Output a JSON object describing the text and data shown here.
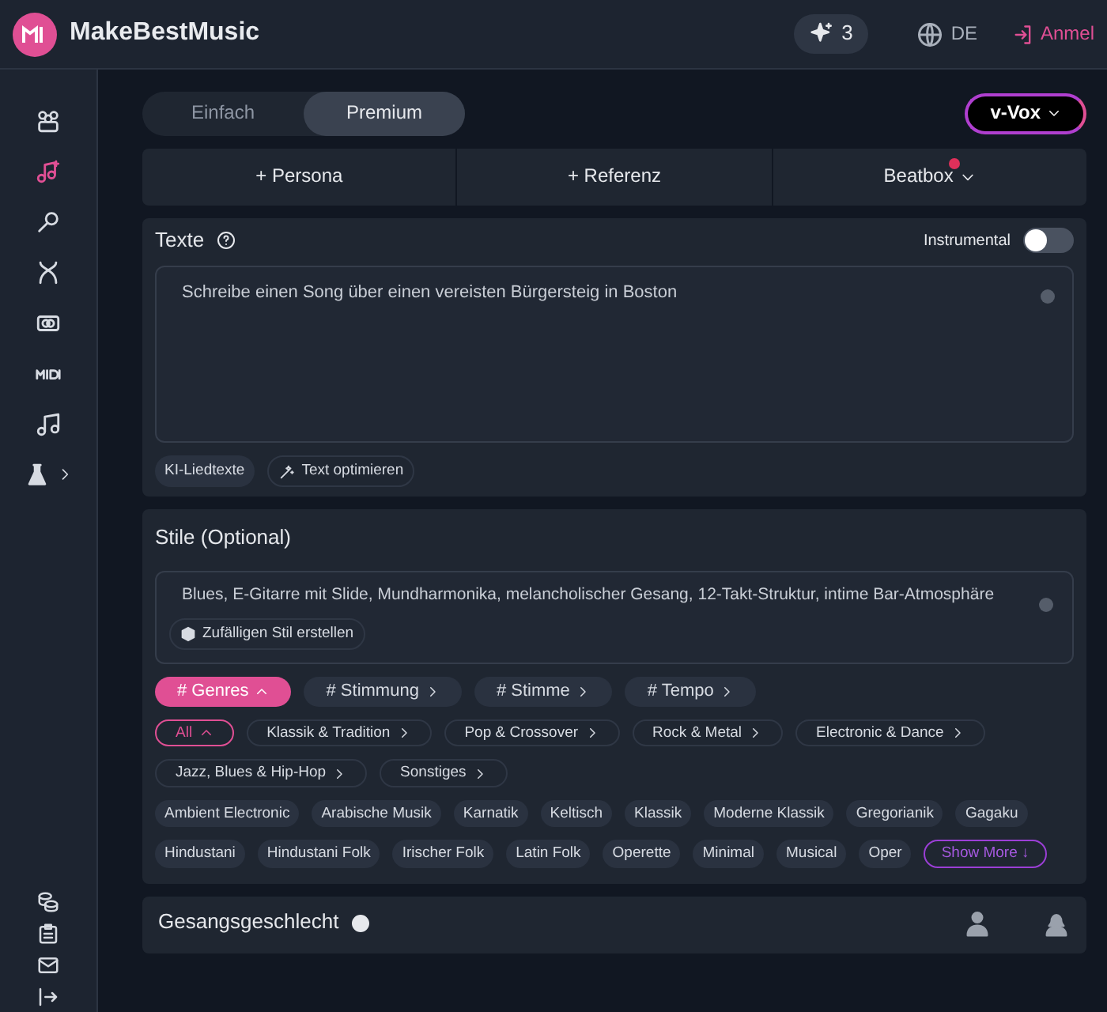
{
  "header": {
    "brand": "MakeBestMusic",
    "credits": "3",
    "language": "DE",
    "login": "Anmel"
  },
  "sidebar": {
    "items": [
      {
        "kind": "link",
        "selected": false
      },
      {
        "kind": "link",
        "selected": true
      },
      {
        "kind": "link",
        "selected": false
      },
      {
        "kind": "link",
        "selected": false
      },
      {
        "kind": "link",
        "selected": false
      },
      {
        "kind": "link",
        "selected": false
      },
      {
        "kind": "link",
        "selected": false
      },
      {
        "kind": "submenu",
        "selected": false
      }
    ]
  },
  "mode_tabs": [
    {
      "label": "Einfach",
      "selected": false
    },
    {
      "label": "Premium",
      "selected": true
    }
  ],
  "model_button": "v-Vox",
  "action_tabs": [
    {
      "label": "+ Persona",
      "kind": "plain"
    },
    {
      "label": "+ Referenz",
      "kind": "plain"
    },
    {
      "label": "Beatbox",
      "kind": "dropdown",
      "notification": true
    }
  ],
  "lyrics": {
    "title": "Texte",
    "instrumental_label": "Instrumental",
    "instrumental_on": false,
    "value": "Schreibe einen Song über einen vereisten Bürgersteig in Boston",
    "buttons": [
      {
        "label": "KI-Liedtexte",
        "kind": "plain"
      },
      {
        "label": "Text optimieren",
        "kind": "wand"
      }
    ]
  },
  "styles": {
    "title": "Stile (Optional)",
    "value": "Blues, E-Gitarre mit Slide, Mundharmonika, melancholischer Gesang, 12-Takt-Struktur, intime Bar-Atmosphäre",
    "random_button": "Zufälligen Stil erstellen",
    "categories": [
      {
        "label": "# Genres",
        "selected": true
      },
      {
        "label": "# Stimmung",
        "selected": false
      },
      {
        "label": "# Stimme",
        "selected": false
      },
      {
        "label": "# Tempo",
        "selected": false
      }
    ],
    "subcategories": [
      {
        "label": "All",
        "selected": true
      },
      {
        "label": "Klassik & Tradition",
        "selected": false
      },
      {
        "label": "Pop & Crossover",
        "selected": false
      },
      {
        "label": "Rock & Metal",
        "selected": false
      },
      {
        "label": "Electronic & Dance",
        "selected": false
      },
      {
        "label": "Jazz, Blues & Hip-Hop",
        "selected": false
      },
      {
        "label": "Sonstiges",
        "selected": false
      }
    ],
    "genres": [
      "Ambient Electronic",
      "Arabische Musik",
      "Karnatik",
      "Keltisch",
      "Klassik",
      "Moderne Klassik",
      "Gregorianik",
      "Gagaku",
      "Hindustani",
      "Hindustani Folk",
      "Irischer Folk",
      "Latin Folk",
      "Operette",
      "Minimal",
      "Musical",
      "Oper"
    ],
    "show_more": "Show More ↓"
  },
  "vocal_gender": {
    "title": "Gesangsgeschlecht"
  }
}
